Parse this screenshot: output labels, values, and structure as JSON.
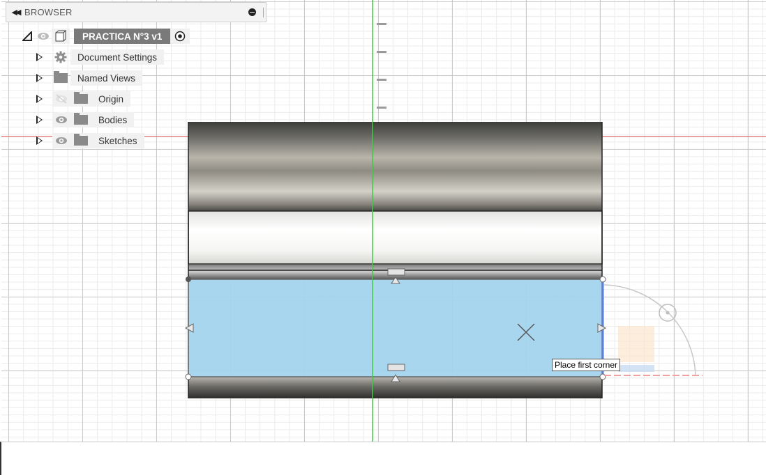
{
  "browser": {
    "title": "BROWSER",
    "root": {
      "label": "PRACTICA N°3 v1"
    },
    "items": [
      {
        "label": "Document Settings",
        "icon": "gear-icon",
        "visible": null
      },
      {
        "label": "Named Views",
        "icon": "folder-icon",
        "visible": null
      },
      {
        "label": "Origin",
        "icon": "folder-icon",
        "visible": false
      },
      {
        "label": "Bodies",
        "icon": "folder-icon",
        "visible": true
      },
      {
        "label": "Sketches",
        "icon": "folder-icon",
        "visible": true
      }
    ]
  },
  "tooltip": {
    "text": "Place first corner"
  },
  "colors": {
    "sketch_fill": "#a3d4ee",
    "x_axis": "#e07070",
    "y_axis": "#3dcc3d",
    "selection_outline": "#5b7fe0"
  }
}
